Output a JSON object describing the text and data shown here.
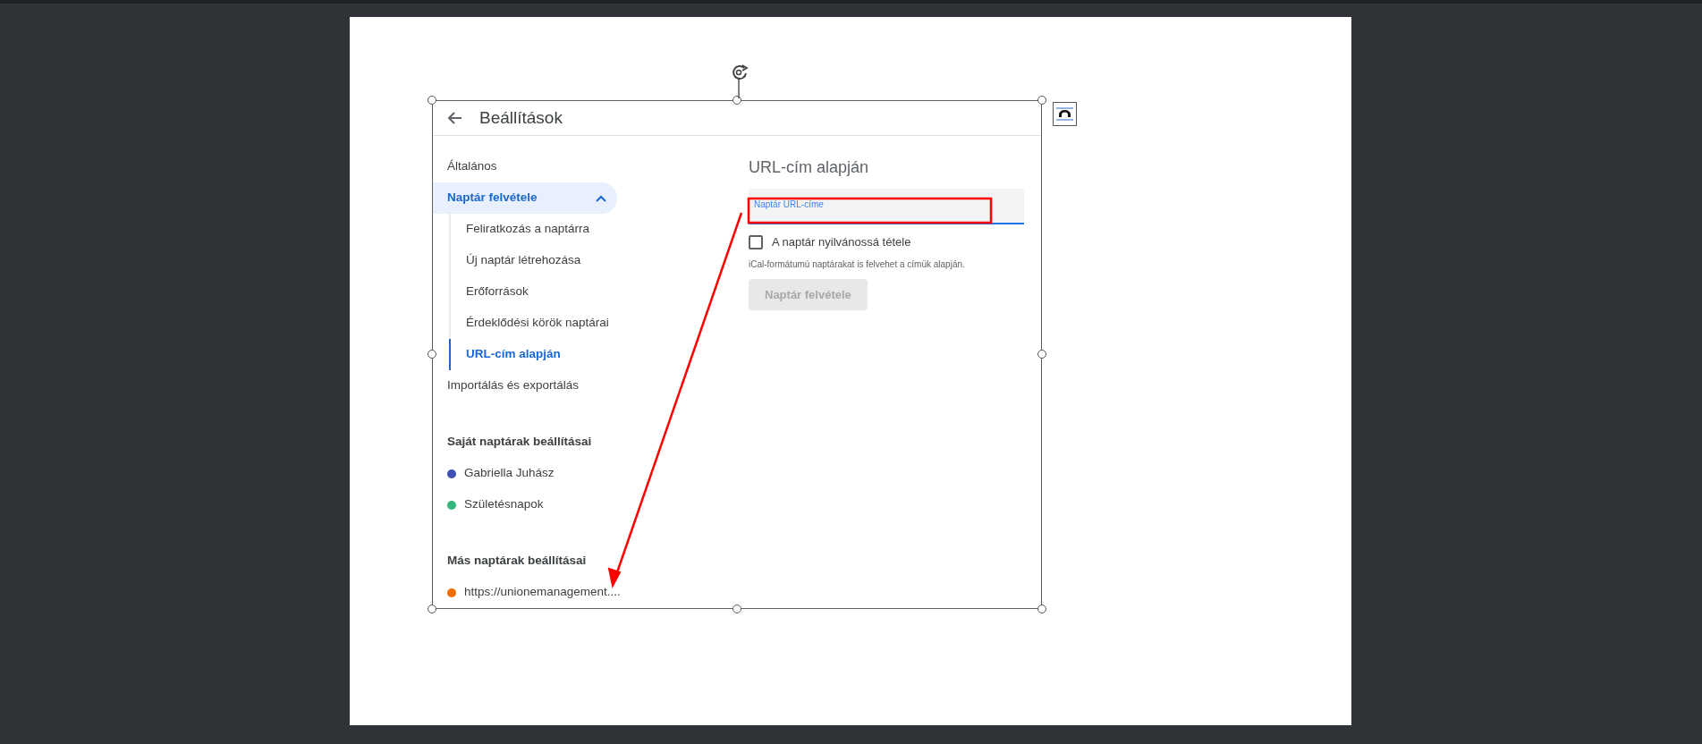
{
  "header": {
    "title": "Beállítások"
  },
  "sidebar": {
    "items": [
      {
        "label": "Általános",
        "selected": false
      },
      {
        "label": "Naptár felvétele",
        "selected": true,
        "expanded": true,
        "children": [
          {
            "label": "Feliratkozás a naptárra",
            "selected": false
          },
          {
            "label": "Új naptár létrehozása",
            "selected": false
          },
          {
            "label": "Erőforrások",
            "selected": false
          },
          {
            "label": "Érdeklődési körök naptárai",
            "selected": false
          },
          {
            "label": "URL-cím alapján",
            "selected": true
          }
        ]
      },
      {
        "label": "Importálás és exportálás",
        "selected": false
      }
    ],
    "sections": [
      {
        "heading": "Saját naptárak beállításai",
        "calendars": [
          {
            "name": "Gabriella Juhász",
            "color": "#3f51b5"
          },
          {
            "name": "Születésnapok",
            "color": "#33b679"
          }
        ]
      },
      {
        "heading": "Más naptárak beállításai",
        "calendars": [
          {
            "name": "https://unionemanagement....",
            "color": "#ef6c00"
          }
        ]
      }
    ]
  },
  "content": {
    "heading": "URL-cím alapján",
    "field": {
      "label": "Naptár URL-címe"
    },
    "checkbox": {
      "label": "A naptár nyilvánossá tétele",
      "checked": false
    },
    "hint": "iCal-formátumú naptárakat is felvehet a címük alapján.",
    "button": {
      "label": "Naptár felvétele",
      "disabled": true
    }
  }
}
